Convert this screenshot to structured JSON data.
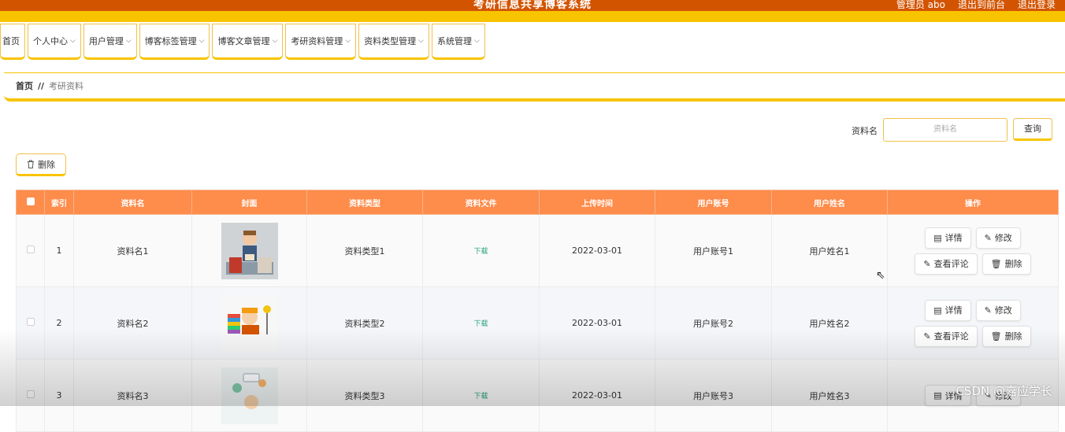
{
  "header": {
    "title": "考研信息共享博客系统",
    "user_label": "管理员 abo",
    "front_link": "退出到前台",
    "logout_link": "退出登录"
  },
  "nav": [
    {
      "label": "首页",
      "has_menu": false
    },
    {
      "label": "个人中心",
      "has_menu": true
    },
    {
      "label": "用户管理",
      "has_menu": true
    },
    {
      "label": "博客标签管理",
      "has_menu": true
    },
    {
      "label": "博客文章管理",
      "has_menu": true
    },
    {
      "label": "考研资料管理",
      "has_menu": true
    },
    {
      "label": "资料类型管理",
      "has_menu": true
    },
    {
      "label": "系统管理",
      "has_menu": true
    }
  ],
  "breadcrumb": {
    "home": "首页",
    "sep": "//",
    "current": "考研资料"
  },
  "search": {
    "label": "资料名",
    "placeholder": "资料名",
    "button": "查询"
  },
  "toolbar": {
    "delete_label": "删除"
  },
  "table": {
    "headers": [
      "索引",
      "资料名",
      "封面",
      "资料类型",
      "资料文件",
      "上传时间",
      "用户账号",
      "用户姓名",
      "操作"
    ],
    "rows": [
      {
        "index": "1",
        "name": "资料名1",
        "cover": "reading-man-illustration",
        "type": "资料类型1",
        "file": "下载",
        "time": "2022-03-01",
        "account": "用户账号1",
        "username": "用户姓名1"
      },
      {
        "index": "2",
        "name": "资料名2",
        "cover": "student-books-lamp-illustration",
        "type": "资料类型2",
        "file": "下载",
        "time": "2022-03-01",
        "account": "用户账号2",
        "username": "用户姓名2"
      },
      {
        "index": "3",
        "name": "资料名3",
        "cover": "study-illustration",
        "type": "资料类型3",
        "file": "下载",
        "time": "2022-03-01",
        "account": "用户账号3",
        "username": "用户姓名3"
      }
    ],
    "actions": {
      "detail": "详情",
      "edit": "修改",
      "comments": "查看评论",
      "delete": "删除"
    }
  },
  "watermark": "CSDN @嘉应学长",
  "colors": {
    "header_dark": "#d35400",
    "accent_yellow": "#f8c400",
    "table_header": "#fe8c4b",
    "link_green": "#2aa27a"
  }
}
